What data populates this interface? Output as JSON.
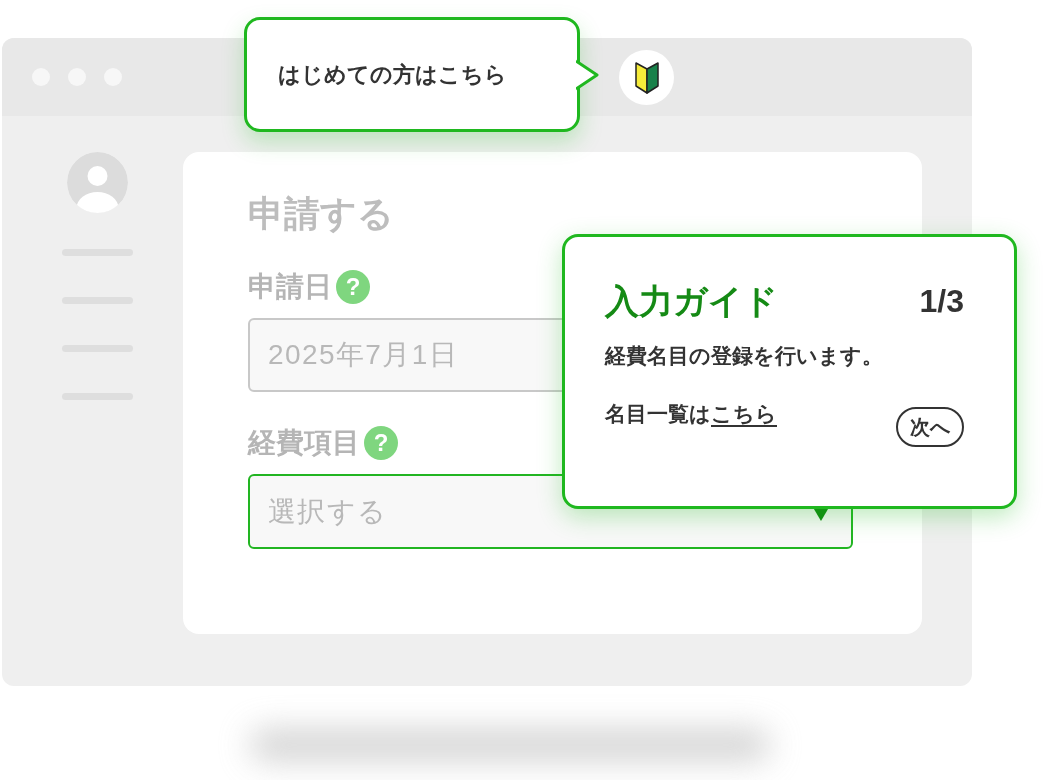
{
  "callout": {
    "text": "はじめての方はこちら"
  },
  "form": {
    "title": "申請する",
    "fields": [
      {
        "label": "申請日",
        "help": "?",
        "kind": "text",
        "value": "2025年7月1日",
        "focused": false
      },
      {
        "label": "経費項目",
        "help": "?",
        "kind": "select",
        "placeholder": "選択する",
        "focused": true
      }
    ]
  },
  "guide": {
    "title": "入力ガイド",
    "step": "1/3",
    "lines": [
      {
        "text": "経費名目の登録を行います。"
      },
      {
        "text": "名目一覧は",
        "link": "こちら"
      }
    ],
    "next_button": "次へ"
  }
}
